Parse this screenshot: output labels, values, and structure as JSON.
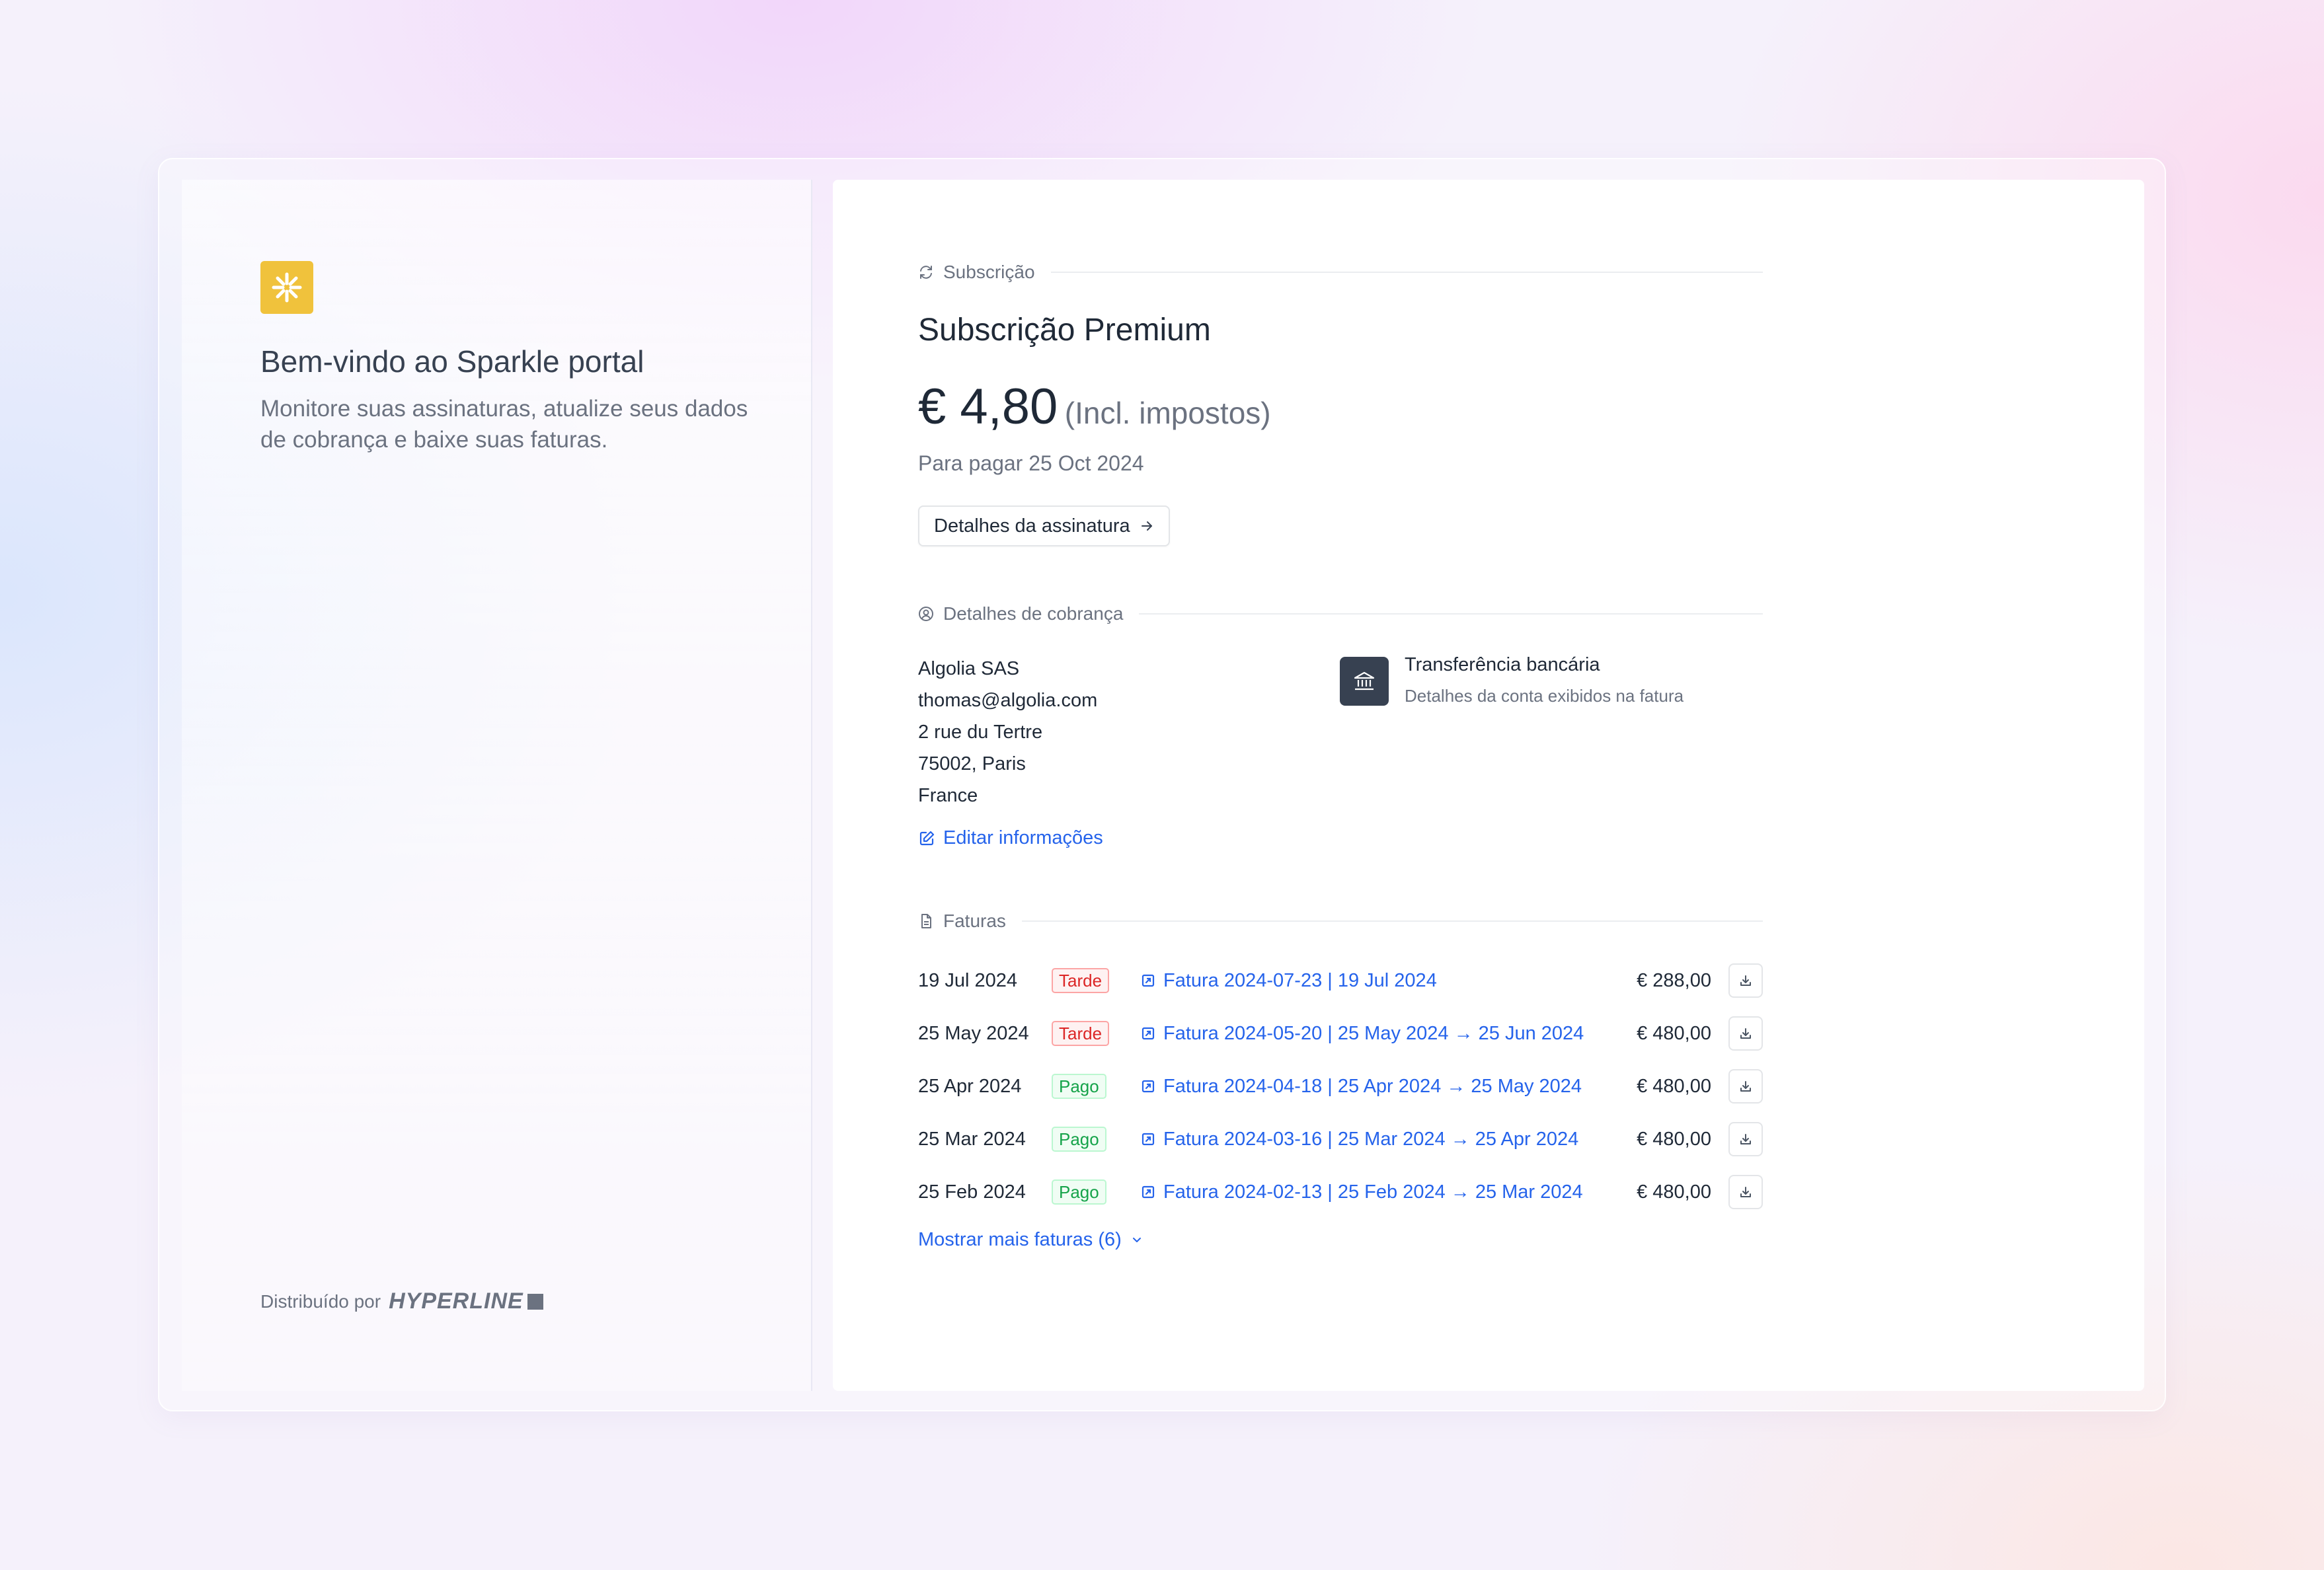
{
  "colors": {
    "accent": "#2563eb",
    "logo": "#f0c23c",
    "late": "#dc2626",
    "paid": "#16a34a"
  },
  "sidebar": {
    "logo_icon": "sparkle-icon",
    "title": "Bem-vindo ao Sparkle portal",
    "subtitle": "Monitore suas assinaturas, atualize seus dados de cobrança e baixe suas faturas.",
    "powered_by": "Distribuído por",
    "brand": "HYPERLINE"
  },
  "subscription": {
    "section_label": "Subscrição",
    "section_icon": "refresh-icon",
    "title": "Subscrição Premium",
    "amount": "€ 4,80",
    "tax_note": "(Incl. impostos)",
    "due": "Para pagar 25 Oct 2024",
    "details_button": "Detalhes da assinatura"
  },
  "billing": {
    "section_label": "Detalhes de cobrança",
    "section_icon": "user-circle-icon",
    "company": "Algolia SAS",
    "email": "thomas@algolia.com",
    "street": "2 rue du Tertre",
    "city": "75002, Paris",
    "country": "France",
    "payment_icon": "bank-icon",
    "payment_method": "Transferência bancária",
    "payment_note": "Detalhes da conta exibidos na fatura",
    "edit_link": "Editar informações"
  },
  "invoices": {
    "section_label": "Faturas",
    "section_icon": "document-icon",
    "rows": [
      {
        "date": "19 Jul 2024",
        "status": "Tarde",
        "link": "Fatura 2024-07-23 | 19 Jul 2024",
        "amount": "€ 288,00"
      },
      {
        "date": "25 May 2024",
        "status": "Tarde",
        "link": "Fatura 2024-05-20 | 25 May 2024 → 25 Jun 2024",
        "amount": "€ 480,00"
      },
      {
        "date": "25 Apr 2024",
        "status": "Pago",
        "link": "Fatura 2024-04-18 | 25 Apr 2024 → 25 May 2024",
        "amount": "€ 480,00"
      },
      {
        "date": "25 Mar 2024",
        "status": "Pago",
        "link": "Fatura 2024-03-16 | 25 Mar 2024 → 25 Apr 2024",
        "amount": "€ 480,00"
      },
      {
        "date": "25 Feb 2024",
        "status": "Pago",
        "link": "Fatura 2024-02-13 | 25 Feb 2024 → 25 Mar 2024",
        "amount": "€ 480,00"
      }
    ],
    "show_more": "Mostrar mais faturas (6)"
  }
}
